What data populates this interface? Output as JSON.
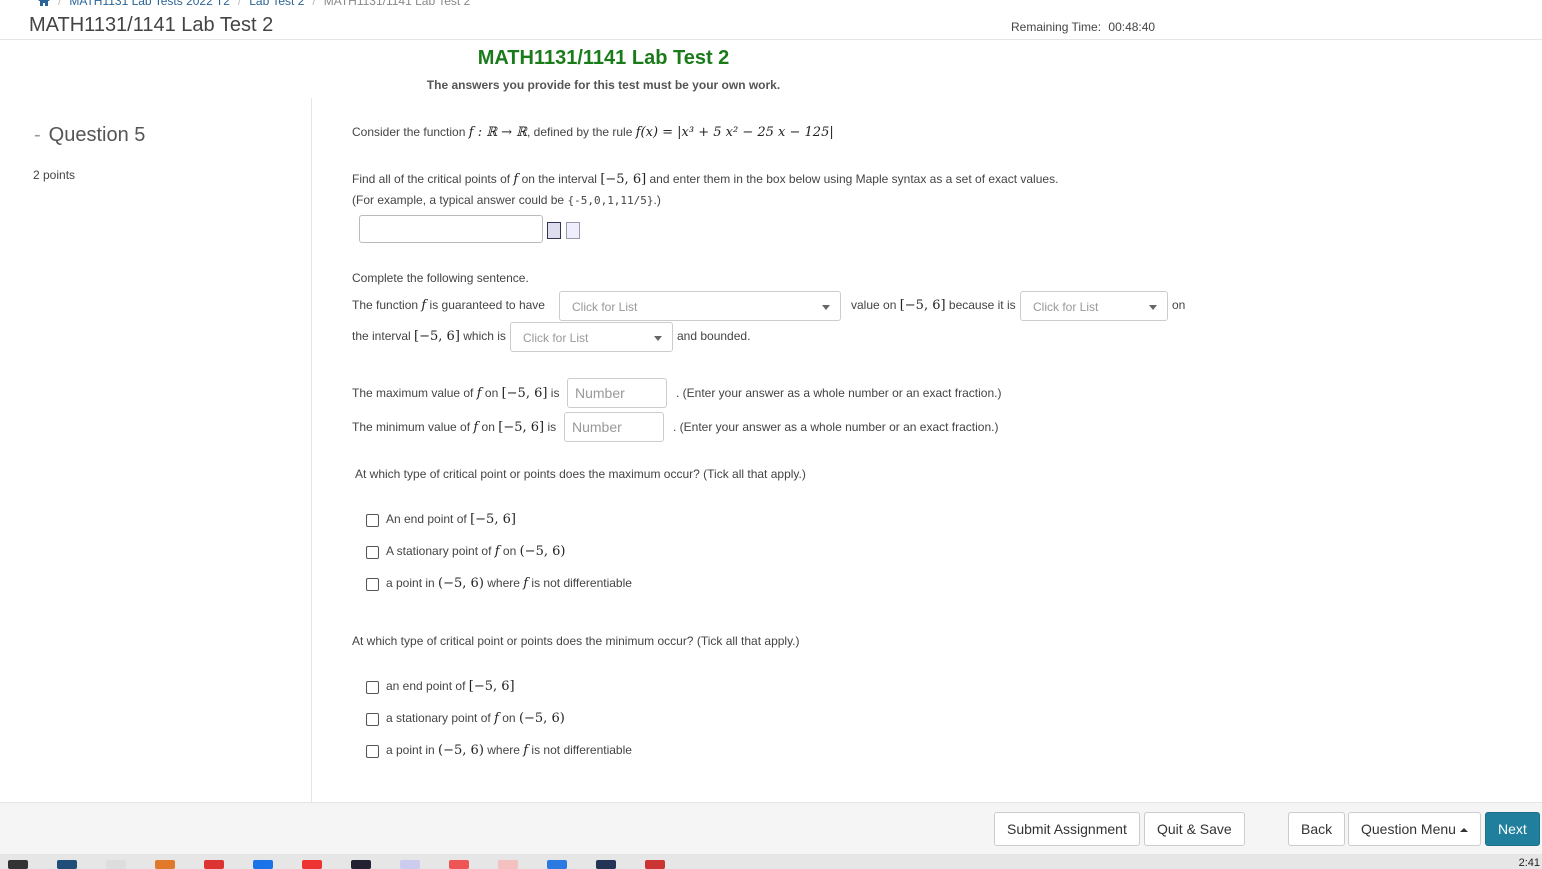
{
  "breadcrumb": {
    "items": [
      "MATH1131 Lab Tests 2022 T2",
      "Lab Test 2",
      "MATH1131/1141 Lab Test 2"
    ]
  },
  "header": {
    "title": "MATH1131/1141 Lab Test 2",
    "remaining_label": "Remaining Time:",
    "remaining_value": "00:48:40"
  },
  "test": {
    "title": "MATH1131/1141 Lab Test 2",
    "notice": "The answers you provide for this test must be your own work."
  },
  "question": {
    "label": "Question 5",
    "points": "2 points"
  },
  "body": {
    "intro_a": "Consider the function",
    "intro_f": "f : ℝ → ℝ",
    "intro_b": ", defined by the rule",
    "intro_rule": "f(x) = |x³ + 5 x² − 25 x − 125|",
    "find_a": "Find all of the critical points of",
    "find_f": "f",
    "find_b": "on the interval",
    "interval": "[−5, 6]",
    "find_c": "and enter them in the box below using Maple syntax as a set of exact values.",
    "example_a": "(For example, a typical answer could be",
    "example_code": "{-5,0,1,11/5}",
    "example_b": ".)",
    "complete": "Complete the following sentence.",
    "s1": "The function",
    "s1_f": "f",
    "s2": "is guaranteed to have",
    "s3": "value on",
    "s4": "because it is",
    "s5": "on",
    "s6": "the interval",
    "s7": "which is",
    "s8": "and bounded.",
    "select_placeholder": "Click for List",
    "max_a": "The maximum value of",
    "min_a": "The minimum value of",
    "on": "on",
    "is": "is",
    "number_placeholder": "Number",
    "enter_hint": ". (Enter your answer as a whole number or an exact fraction.)",
    "max_q": "At which type of critical point or points does the maximum occur? (Tick all that apply.)",
    "min_q": "At which type of critical point or points does the minimum occur? (Tick all that apply.)",
    "open_interval": "(−5, 6)",
    "max_options": [
      {
        "a": "An end point of",
        "m": "[−5, 6]",
        "b": ""
      },
      {
        "a": "A stationary point of",
        "f": "f",
        "on": "on",
        "m": "(−5, 6)",
        "b": ""
      },
      {
        "a": "a point in",
        "m": "(−5, 6)",
        "b": "where",
        "f": "f",
        "c": "is not differentiable"
      }
    ],
    "min_options": [
      {
        "a": "an end point of",
        "m": "[−5, 6]",
        "b": ""
      },
      {
        "a": "a stationary point of",
        "f": "f",
        "on": "on",
        "m": "(−5, 6)",
        "b": ""
      },
      {
        "a": "a point in",
        "m": "(−5, 6)",
        "b": "where",
        "f": "f",
        "c": "is not differentiable"
      }
    ]
  },
  "footer": {
    "submit": "Submit Assignment",
    "quit": "Quit & Save",
    "back": "Back",
    "question_menu": "Question Menu",
    "next": "Next"
  },
  "taskbar": {
    "clock": "2:41"
  }
}
